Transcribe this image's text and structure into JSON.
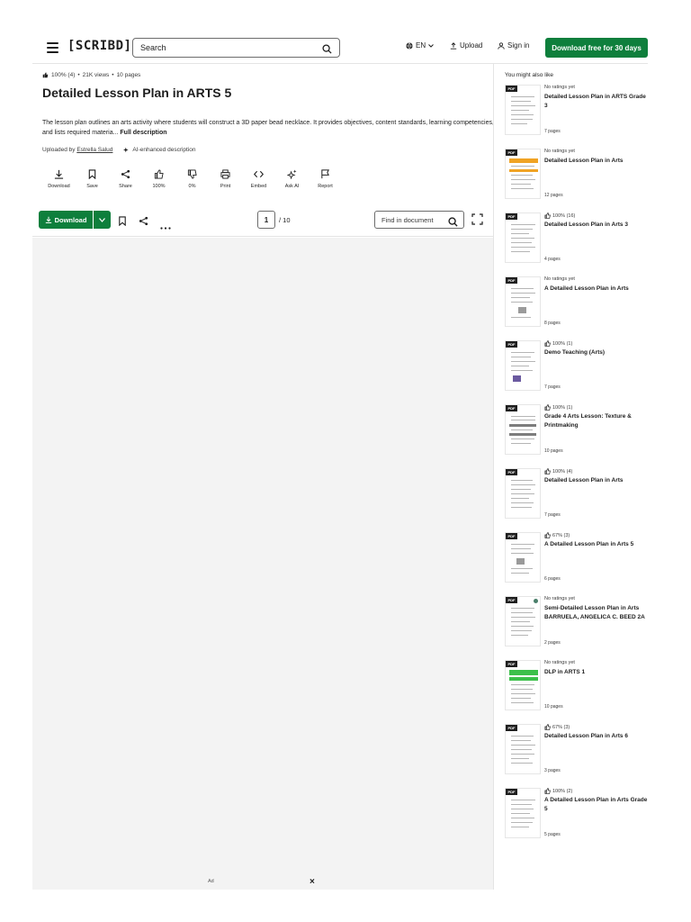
{
  "header": {
    "logo": "[SCRIBD]",
    "search_placeholder": "Search",
    "language": "EN",
    "upload": "Upload",
    "sign_in": "Sign in",
    "cta": "Download free for 30 days"
  },
  "document": {
    "rating": "100% (4)",
    "views": "21K views",
    "pages": "10 pages",
    "title": "Detailed Lesson Plan in ARTS 5",
    "description": "The lesson plan outlines an arts activity where students will construct a 3D paper bead necklace. It provides objectives, content standards, learning competencies, and lists required materia...",
    "full_description": "Full description",
    "uploaded_by_label": "Uploaded by",
    "uploader": "Estrella Salud",
    "ai_note": "AI-enhanced description"
  },
  "actions": [
    {
      "label": "Download",
      "icon": "download-icon"
    },
    {
      "label": "Save",
      "icon": "bookmark-icon"
    },
    {
      "label": "Share",
      "icon": "share-icon"
    },
    {
      "label": "100%",
      "icon": "thumbs-up-icon"
    },
    {
      "label": "0%",
      "icon": "thumbs-down-icon"
    },
    {
      "label": "Print",
      "icon": "print-icon"
    },
    {
      "label": "Embed",
      "icon": "embed-icon"
    },
    {
      "label": "Ask AI",
      "icon": "sparkle-icon"
    },
    {
      "label": "Report",
      "icon": "flag-icon"
    }
  ],
  "toolbar": {
    "download": "Download",
    "current_page": "1",
    "total_pages": "/ 10",
    "find_placeholder": "Find in document"
  },
  "ad": {
    "label": "Ad",
    "close": "×"
  },
  "sidebar": {
    "title": "You might also like",
    "items": [
      {
        "badge": "PDF",
        "rating": "No ratings yet",
        "title": "Detailed Lesson Plan in ARTS Grade 3",
        "pages": "7 pages"
      },
      {
        "badge": "PDF",
        "rating": "No ratings yet",
        "title": "Detailed Lesson Plan in Arts",
        "pages": "12 pages"
      },
      {
        "badge": "PDF",
        "rating": "100% (16)",
        "title": "Detailed Lesson Plan in Arts 3",
        "pages": "4 pages"
      },
      {
        "badge": "PDF",
        "rating": "No ratings yet",
        "title": "A Detailed Lesson Plan in Arts",
        "pages": "8 pages"
      },
      {
        "badge": "PDF",
        "rating": "100% (1)",
        "title": "Demo Teaching (Arts)",
        "pages": "7 pages"
      },
      {
        "badge": "PDF",
        "rating": "100% (1)",
        "title": "Grade 4 Arts Lesson: Texture & Printmaking",
        "pages": "10 pages"
      },
      {
        "badge": "PDF",
        "rating": "100% (4)",
        "title": "Detailed Lesson Plan in Arts",
        "pages": "7 pages"
      },
      {
        "badge": "PDF",
        "rating": "67% (3)",
        "title": "A Detailed Lesson Plan in Arts 5",
        "pages": "6 pages"
      },
      {
        "badge": "PDF",
        "rating": "No ratings yet",
        "title": "Semi-Detailed Lesson Plan in Arts BARRUELA, ANGELICA C. BEED 2A",
        "pages": "2 pages"
      },
      {
        "badge": "PDF",
        "rating": "No ratings yet",
        "title": "DLP in ARTS 1",
        "pages": "10 pages"
      },
      {
        "badge": "PDF",
        "rating": "67% (3)",
        "title": "Detailed Lesson Plan in Arts 6",
        "pages": "3 pages"
      },
      {
        "badge": "PDF",
        "rating": "100% (2)",
        "title": "A Detailed Lesson Plan in Arts Grade 5",
        "pages": "5 pages"
      }
    ]
  },
  "colors": {
    "brand_green": "#0e7f3c",
    "text": "#1e1e1e",
    "border": "#e4e4e4",
    "viewer_bg": "#f3f3f3"
  }
}
